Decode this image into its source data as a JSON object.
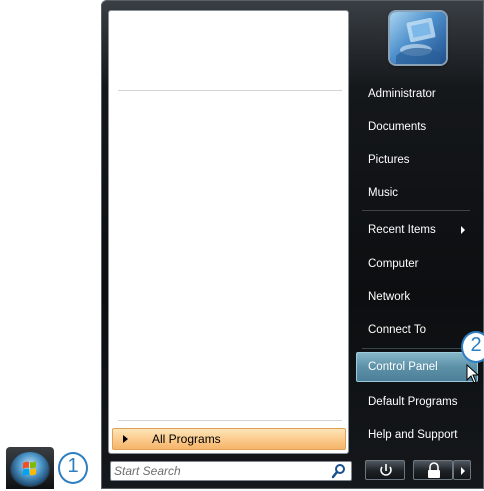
{
  "start_menu": {
    "all_programs_label": "All Programs",
    "search_placeholder": "Start Search"
  },
  "right_pane": {
    "items": [
      {
        "label": "Administrator"
      },
      {
        "label": "Documents"
      },
      {
        "label": "Pictures"
      },
      {
        "label": "Music"
      },
      {
        "label": "Recent Items"
      },
      {
        "label": "Computer"
      },
      {
        "label": "Network"
      },
      {
        "label": "Connect To"
      },
      {
        "label": "Control Panel"
      },
      {
        "label": "Default Programs"
      },
      {
        "label": "Help and Support"
      }
    ],
    "selected_item": "Control Panel"
  },
  "callouts": {
    "step1": "1",
    "step2": "2"
  },
  "icons": {
    "search": "search-icon",
    "power": "power-icon",
    "lock": "lock-icon",
    "more": "arrow-right-icon",
    "start": "windows-logo-icon",
    "cursor": "mouse-pointer-icon"
  },
  "colors": {
    "callout": "#2d7fc2",
    "highlight": "#5c91a8",
    "all_programs": "#fbc98a"
  }
}
